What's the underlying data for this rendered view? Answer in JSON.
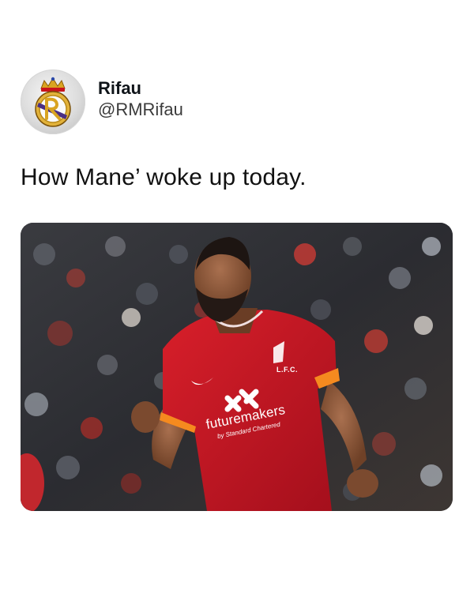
{
  "tweet": {
    "author": {
      "display_name": "Rifau",
      "handle": "@RMRifau",
      "avatar_icon": "real-madrid-crest-icon"
    },
    "text": "How Mane’ woke up today.",
    "media": {
      "alt_icon": "football-player-celebrating-photo",
      "shirt": {
        "club_abbr": "L.F.C.",
        "sponsor": "futuremakers",
        "sponsor_sub": "by Standard Chartered"
      },
      "colors": {
        "kit_red": "#c8102e",
        "crowd": "#2a2d31"
      }
    }
  }
}
